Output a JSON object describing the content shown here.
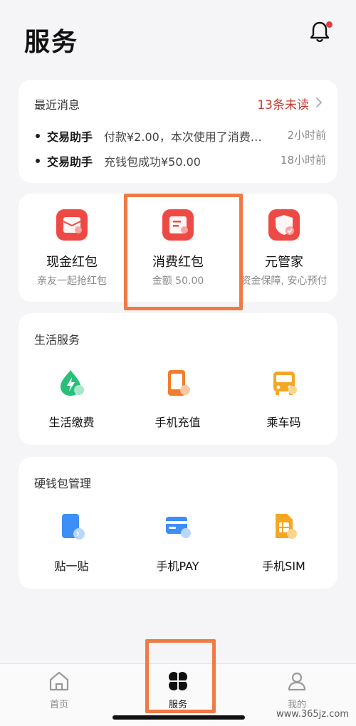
{
  "header": {
    "title": "服务",
    "bell_icon": "bell-icon"
  },
  "messages": {
    "title": "最近消息",
    "unread": "13条未读",
    "items": [
      {
        "sender": "交易助手",
        "content": "付款¥2.00，本次使用了消费…",
        "time": "2小时前"
      },
      {
        "sender": "交易助手",
        "content": "充钱包成功¥50.00",
        "time": "18小时前"
      }
    ]
  },
  "red_packets": [
    {
      "title": "现金红包",
      "subtitle": "亲友一起抢红包",
      "icon": "cash-red-packet-icon"
    },
    {
      "title": "消费红包",
      "subtitle": "金额 50.00",
      "icon": "consumer-red-packet-icon"
    },
    {
      "title": "元管家",
      "subtitle": "资金保障, 安心预付",
      "icon": "shield-icon"
    }
  ],
  "life_services": {
    "title": "生活服务",
    "items": [
      {
        "label": "生活缴费",
        "icon": "utility-payment-icon"
      },
      {
        "label": "手机充值",
        "icon": "phone-topup-icon"
      },
      {
        "label": "乘车码",
        "icon": "bus-code-icon"
      }
    ]
  },
  "hard_wallet": {
    "title": "硬钱包管理",
    "items": [
      {
        "label": "贴一贴",
        "icon": "tap-icon"
      },
      {
        "label": "手机PAY",
        "icon": "phone-pay-icon"
      },
      {
        "label": "手机SIM",
        "icon": "sim-icon"
      }
    ]
  },
  "nav": {
    "items": [
      {
        "label": "首页",
        "icon": "home-icon"
      },
      {
        "label": "服务",
        "icon": "services-icon",
        "active": true
      },
      {
        "label": "我的",
        "icon": "profile-icon"
      }
    ]
  },
  "watermark": "www.365jz.com",
  "colors": {
    "accent_red": "#e8443f",
    "highlight": "#f07a46",
    "unread": "#c8382e"
  }
}
